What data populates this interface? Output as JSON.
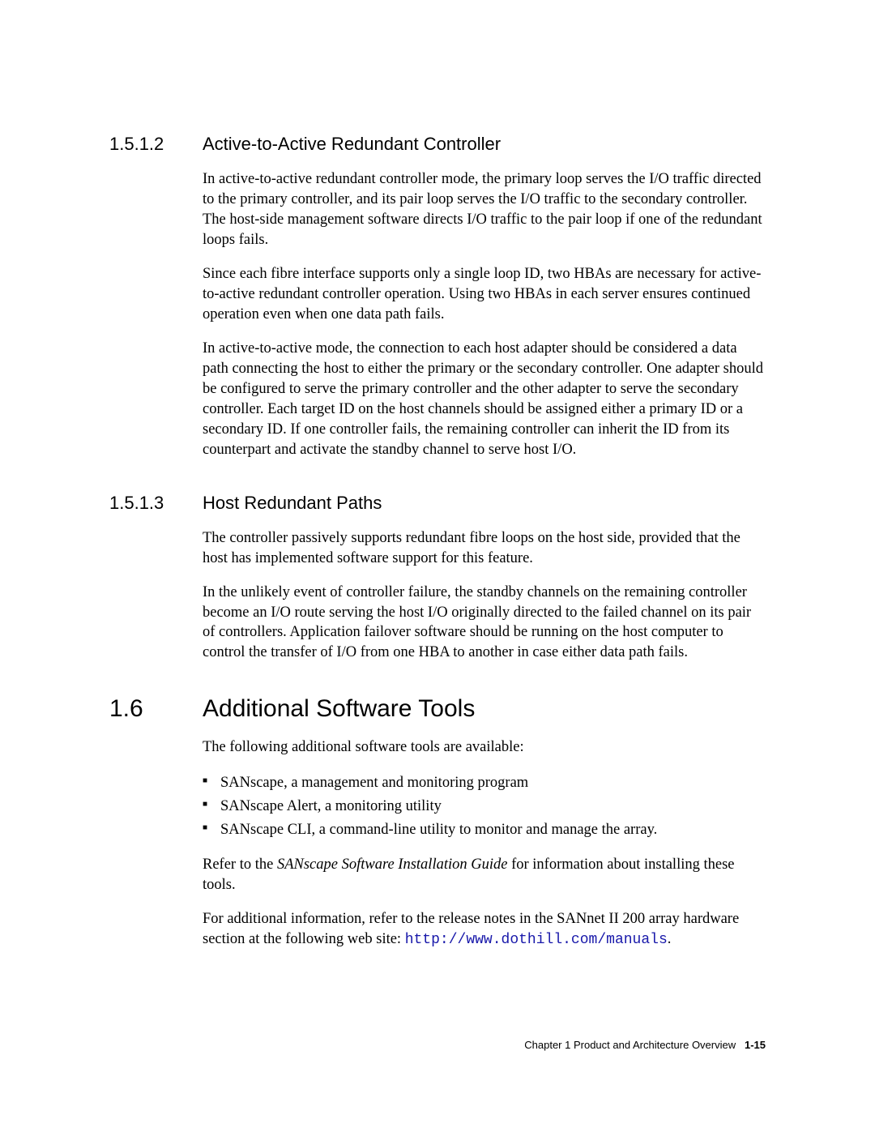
{
  "sections": {
    "s1512": {
      "number": "1.5.1.2",
      "title": "Active-to-Active Redundant Controller",
      "p1": "In active-to-active redundant controller mode, the primary loop serves the I/O traffic directed to the primary controller, and its pair loop serves the I/O traffic to the secondary controller. The host-side management software directs I/O traffic to the pair loop if one of the redundant loops fails.",
      "p2": "Since each fibre interface supports only a single loop ID, two HBAs are necessary for active-to-active redundant controller operation. Using two HBAs in each server ensures continued operation even when one data path fails.",
      "p3": "In active-to-active mode, the connection to each host adapter should be considered a data path connecting the host to either the primary or the secondary controller. One adapter should be configured to serve the primary controller and the other adapter to serve the secondary controller. Each target ID on the host channels should be assigned either a primary ID or a secondary ID. If one controller fails, the remaining controller can inherit the ID from its counterpart and activate the standby channel to serve host I/O."
    },
    "s1513": {
      "number": "1.5.1.3",
      "title": "Host Redundant Paths",
      "p1": "The controller passively supports redundant fibre loops on the host side, provided that the host has implemented software support for this feature.",
      "p2": "In the unlikely event of controller failure, the standby channels on the remaining controller become an I/O route serving the host I/O originally directed to the failed channel on its pair of controllers. Application failover software should be running on the host computer to control the transfer of I/O from one HBA to another in case either data path fails."
    },
    "s16": {
      "number": "1.6",
      "title": "Additional Software Tools",
      "p1": "The following additional software tools are available:",
      "bullets": {
        "b1": "SANscape, a management and monitoring program",
        "b2": "SANscape Alert, a monitoring utility",
        "b3": "SANscape CLI, a command-line utility to monitor and manage the array."
      },
      "p2_pre": "Refer to the ",
      "p2_italic": "SANscape Software Installation Guide",
      "p2_post": " for information about installing these tools.",
      "p3_pre": "For additional information, refer to the release notes in the SANnet II 200 array hardware section at the following web site: ",
      "p3_link": "http://www.dothill.com/manuals",
      "p3_post": "."
    }
  },
  "footer": {
    "chapter": "Chapter  1   Product and Architecture Overview",
    "page": "1-15"
  }
}
